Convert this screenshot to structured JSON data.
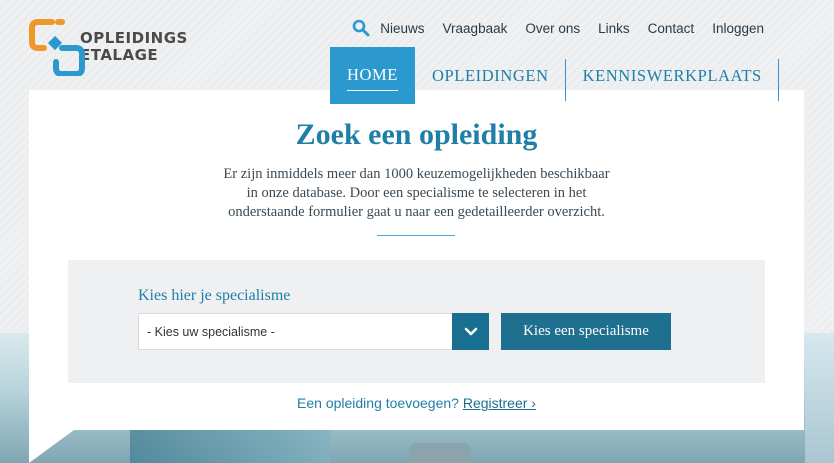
{
  "logo": {
    "line1": "OPLEIDINGS",
    "line2": "ETALAGE",
    "colors": {
      "orange": "#f0972a",
      "blue": "#2b99cd"
    }
  },
  "top_nav": {
    "search_icon": "search-icon",
    "items": [
      "Nieuws",
      "Vraagbaak",
      "Over ons",
      "Links",
      "Contact",
      "Inloggen"
    ]
  },
  "main_nav": {
    "items": [
      {
        "label": "HOME",
        "active": true
      },
      {
        "label": "OPLEIDINGEN",
        "active": false
      },
      {
        "label": "KENNISWERKPLAATS",
        "active": false
      }
    ]
  },
  "content": {
    "title": "Zoek een opleiding",
    "intro_lines": [
      "Er zijn inmiddels meer dan 1000 keuzemogelijkheden beschikbaar",
      "in onze database. Door een specialisme te selecteren in het",
      "onderstaande formulier gaat u naar een gedetailleerder overzicht."
    ]
  },
  "form": {
    "label": "Kies hier je specialisme",
    "select_value": "- Kies uw specialisme -",
    "select_icon": "chevron-down-icon",
    "button_label": "Kies een specialisme"
  },
  "footer": {
    "text": "Een opleiding toevoegen?",
    "link": "Registreer ›"
  },
  "colors": {
    "accent": "#2b99cd",
    "dark_accent": "#1f6f8e",
    "title": "#1f7fa7"
  }
}
